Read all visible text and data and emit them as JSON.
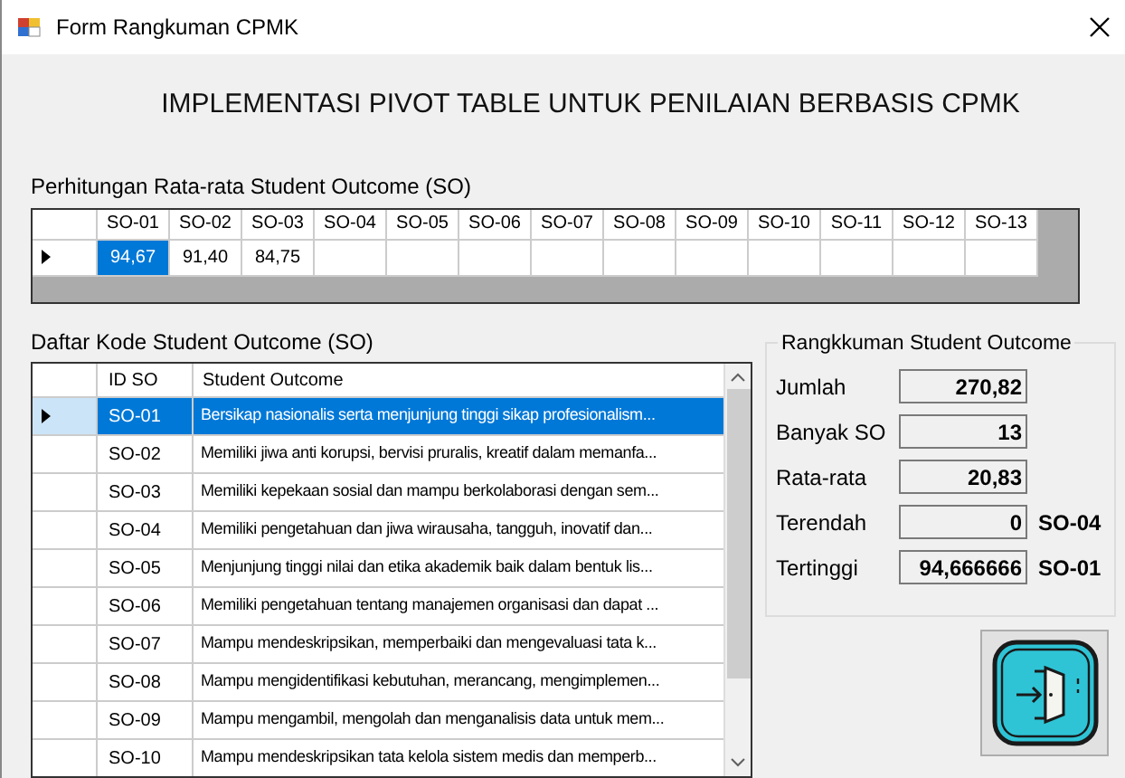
{
  "window": {
    "title": "Form Rangkuman CPMK"
  },
  "heading": "IMPLEMENTASI PIVOT TABLE UNTUK PENILAIAN BERBASIS CPMK",
  "average_grid": {
    "label": "Perhitungan Rata-rata Student Outcome (SO)",
    "columns": [
      "SO-01",
      "SO-02",
      "SO-03",
      "SO-04",
      "SO-05",
      "SO-06",
      "SO-07",
      "SO-08",
      "SO-09",
      "SO-10",
      "SO-11",
      "SO-12",
      "SO-13"
    ],
    "rows": [
      {
        "current": true,
        "cells": [
          {
            "value": "94,67",
            "selected": true
          },
          {
            "value": "91,40",
            "selected": false
          },
          {
            "value": "84,75",
            "selected": false
          }
        ]
      }
    ]
  },
  "so_grid": {
    "label": "Daftar Kode Student Outcome (SO)",
    "columns": [
      "ID SO",
      "Student Outcome"
    ],
    "rows": [
      {
        "id": "SO-01",
        "outcome": "Bersikap nasionalis serta menjunjung tinggi sikap profesionalism...",
        "selected": true
      },
      {
        "id": "SO-02",
        "outcome": "Memiliki jiwa anti korupsi, bervisi pruralis, kreatif dalam memanfa...",
        "selected": false
      },
      {
        "id": "SO-03",
        "outcome": "Memiliki kepekaan sosial dan mampu berkolaborasi dengan sem...",
        "selected": false
      },
      {
        "id": "SO-04",
        "outcome": "Memiliki pengetahuan dan jiwa wirausaha, tangguh, inovatif dan...",
        "selected": false
      },
      {
        "id": "SO-05",
        "outcome": "Menjunjung tinggi nilai dan etika akademik baik dalam bentuk lis...",
        "selected": false
      },
      {
        "id": "SO-06",
        "outcome": "Memiliki pengetahuan tentang manajemen organisasi dan dapat ...",
        "selected": false
      },
      {
        "id": "SO-07",
        "outcome": "Mampu mendeskripsikan, memperbaiki dan mengevaluasi tata k...",
        "selected": false
      },
      {
        "id": "SO-08",
        "outcome": "Mampu mengidentifikasi kebutuhan, merancang, mengimplemen...",
        "selected": false
      },
      {
        "id": "SO-09",
        "outcome": "Mampu mengambil, mengolah dan menganalisis data untuk mem...",
        "selected": false
      },
      {
        "id": "SO-10",
        "outcome": "Mampu mendeskripsikan tata kelola sistem medis dan memperb...",
        "selected": false
      }
    ]
  },
  "summary": {
    "title": "Rangkkuman Student Outcome",
    "fields": [
      {
        "label": "Jumlah",
        "value": "270,82"
      },
      {
        "label": "Banyak SO",
        "value": "13"
      },
      {
        "label": "Rata-rata",
        "value": "20,83"
      },
      {
        "label": "Terendah",
        "value": "0",
        "note": "SO-04"
      },
      {
        "label": "Tertinggi",
        "value": "94,666666",
        "note": "SO-01"
      }
    ]
  }
}
